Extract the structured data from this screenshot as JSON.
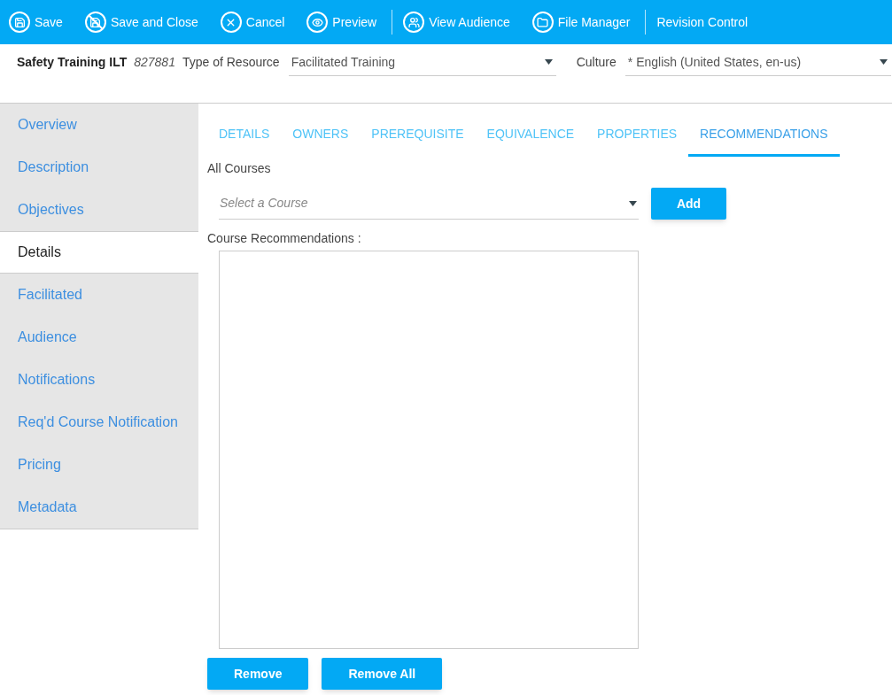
{
  "toolbar": [
    {
      "label": "Save",
      "kind": "save",
      "divider_before": false
    },
    {
      "label": "Save and Close",
      "kind": "save_close",
      "divider_before": false
    },
    {
      "label": "Cancel",
      "kind": "cancel",
      "divider_before": false
    },
    {
      "label": "Preview",
      "kind": "preview",
      "divider_before": false
    },
    {
      "label": "View Audience",
      "kind": "audience",
      "divider_before": true
    },
    {
      "label": "File Manager",
      "kind": "folder",
      "divider_before": false
    },
    {
      "label": "Revision Control",
      "kind": "text",
      "divider_before": true
    }
  ],
  "header": {
    "title": "Safety Training ILT",
    "id": "827881",
    "type_label": "Type of Resource",
    "type_value": "Facilitated Training",
    "culture_label": "Culture",
    "culture_value": "* English (United States, en-us)"
  },
  "sidebar": [
    {
      "label": "Overview",
      "selected": false
    },
    {
      "label": "Description",
      "selected": false
    },
    {
      "label": "Objectives",
      "selected": false
    },
    {
      "label": "Details",
      "selected": true
    },
    {
      "label": "Facilitated",
      "selected": false
    },
    {
      "label": "Audience",
      "selected": false
    },
    {
      "label": "Notifications",
      "selected": false
    },
    {
      "label": "Req'd Course Notification",
      "selected": false
    },
    {
      "label": "Pricing",
      "selected": false
    },
    {
      "label": "Metadata",
      "selected": false
    }
  ],
  "tabs": [
    {
      "label": "DETAILS",
      "selected": false
    },
    {
      "label": "OWNERS",
      "selected": false
    },
    {
      "label": "PREREQUISITE",
      "selected": false
    },
    {
      "label": "EQUIVALENCE",
      "selected": false
    },
    {
      "label": "PROPERTIES",
      "selected": false
    },
    {
      "label": "RECOMMENDATIONS",
      "selected": true
    }
  ],
  "all_courses_label": "All Courses",
  "course_select": {
    "placeholder": "Select a Course"
  },
  "add_button": "Add",
  "recommendations_label": "Course Recommendations :",
  "buttons": [
    "Remove",
    "Remove All"
  ]
}
